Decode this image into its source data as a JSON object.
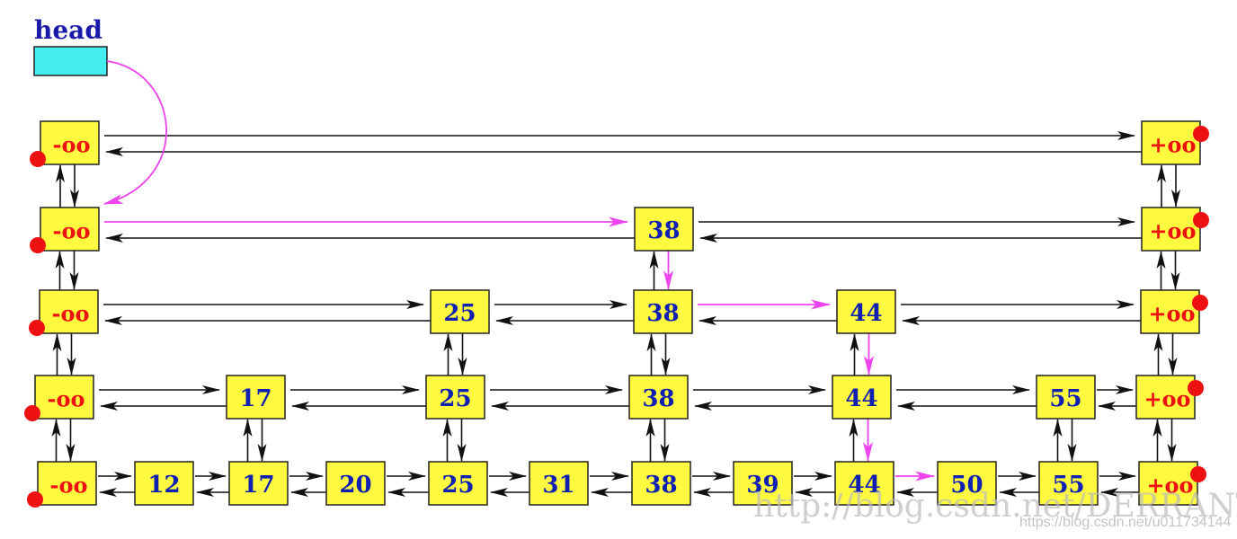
{
  "head": {
    "label": "head",
    "fill": "#44eef0"
  },
  "colors": {
    "node_fill": "#fffa40",
    "value_text": "#1020b0",
    "sentinel_text": "#ee1111",
    "dot": "#ee1111",
    "link": "#111111",
    "search_path": "#ee44ee"
  },
  "sentinels": {
    "neg_inf": "-oo",
    "pos_inf": "+oo"
  },
  "levels": [
    {
      "level": 0,
      "keys": [
        "-oo",
        "12",
        "17",
        "20",
        "25",
        "31",
        "38",
        "39",
        "44",
        "50",
        "55",
        "+oo"
      ]
    },
    {
      "level": 1,
      "keys": [
        "-oo",
        "17",
        "25",
        "38",
        "44",
        "55",
        "+oo"
      ]
    },
    {
      "level": 2,
      "keys": [
        "-oo",
        "25",
        "38",
        "44",
        "+oo"
      ]
    },
    {
      "level": 3,
      "keys": [
        "-oo",
        "38",
        "+oo"
      ]
    },
    {
      "level": 4,
      "keys": [
        "-oo",
        "+oo"
      ]
    }
  ],
  "search_path": [
    {
      "from": "head",
      "to": "L3:-oo"
    },
    {
      "from": "L3:-oo",
      "to": "L3:38"
    },
    {
      "from": "L3:38",
      "to": "L2:38"
    },
    {
      "from": "L2:38",
      "to": "L2:44"
    },
    {
      "from": "L2:44",
      "to": "L1:44"
    },
    {
      "from": "L1:44",
      "to": "L0:44"
    },
    {
      "from": "L0:44",
      "to": "L0:50"
    }
  ],
  "watermark": {
    "primary": "http://blog.csdn.net/DERRANTCM",
    "secondary": "https://blog.csdn.net/u011734144"
  }
}
